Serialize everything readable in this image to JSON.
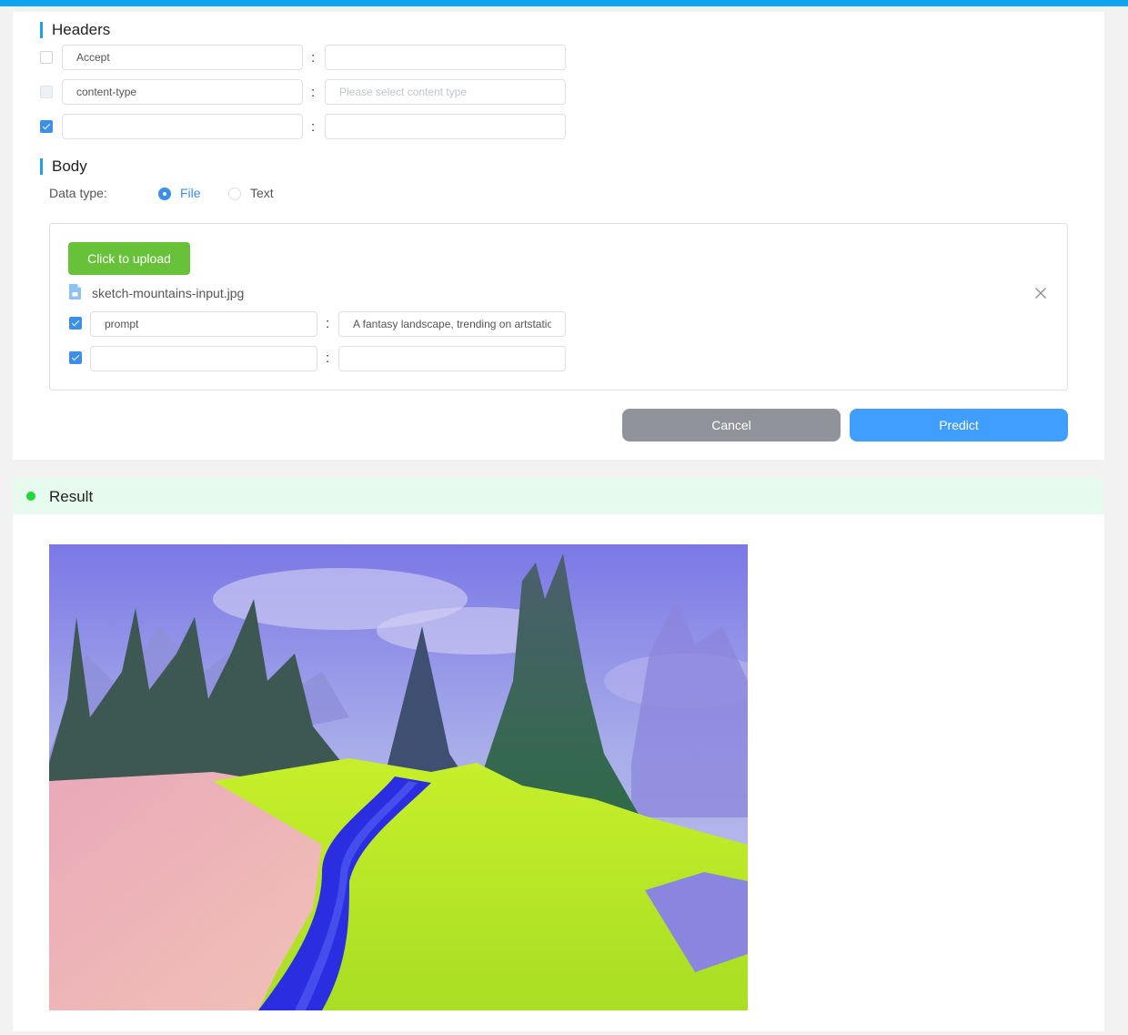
{
  "headers": {
    "title": "Headers",
    "rows": [
      {
        "key": "Accept",
        "key_placeholder": "",
        "value": "",
        "value_placeholder": "",
        "checked": false,
        "disabled": false
      },
      {
        "key": "content-type",
        "key_placeholder": "",
        "value": "",
        "value_placeholder": "Please select content type",
        "checked": false,
        "disabled": true
      },
      {
        "key": "",
        "key_placeholder": "",
        "value": "",
        "value_placeholder": "",
        "checked": true,
        "disabled": false
      }
    ],
    "separator": ":"
  },
  "body": {
    "title": "Body",
    "data_type_label": "Data type:",
    "options": [
      {
        "label": "File",
        "selected": true
      },
      {
        "label": "Text",
        "selected": false
      }
    ],
    "upload_button": "Click to upload",
    "file_name": "sketch-mountains-input.jpg",
    "params": [
      {
        "key": "prompt",
        "value": "A fantasy landscape, trending on artstation",
        "checked": true
      },
      {
        "key": "",
        "value": "",
        "checked": true
      }
    ],
    "separator": ":"
  },
  "actions": {
    "cancel": "Cancel",
    "predict": "Predict"
  },
  "result": {
    "title": "Result",
    "status_color": "#1fd93a"
  },
  "colors": {
    "accent": "#0ea5f0",
    "primary": "#409eff",
    "success": "#67c23a",
    "neutral": "#909399"
  }
}
